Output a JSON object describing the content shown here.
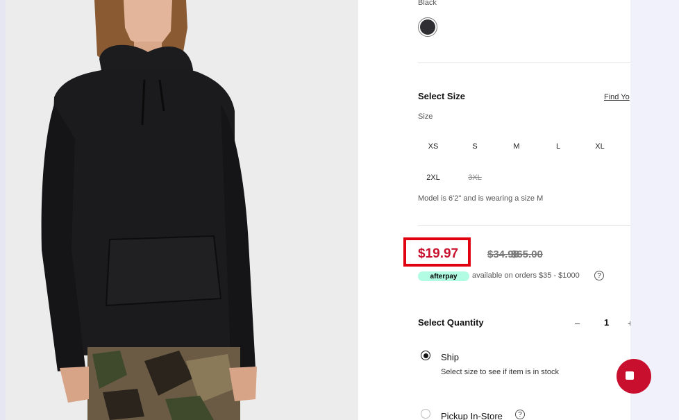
{
  "product": {
    "color_name": "Black",
    "swatch_color": "#2f2f33"
  },
  "size_section": {
    "title": "Select Size",
    "find_link": "Find Yo",
    "size_label": "Size",
    "sizes": [
      {
        "label": "XS",
        "available": true
      },
      {
        "label": "S",
        "available": true
      },
      {
        "label": "M",
        "available": true
      },
      {
        "label": "L",
        "available": true
      },
      {
        "label": "XL",
        "available": true
      },
      {
        "label": "2XL",
        "available": true
      },
      {
        "label": "3XL",
        "available": false
      }
    ],
    "model_note": "Model is 6'2\" and is wearing a size M"
  },
  "pricing": {
    "current_price": "$19.97",
    "old_price_1": "$34.98",
    "old_price_2": "$65.00",
    "afterpay_label": "afterpay",
    "afterpay_text": "available on orders $35 - $1000",
    "sale_color": "#c8102e",
    "highlight_color": "#e00010"
  },
  "quantity": {
    "label": "Select Quantity",
    "minus": "–",
    "value": "1",
    "plus": "+"
  },
  "fulfillment": {
    "ship_label": "Ship",
    "ship_sub": "Select size to see if item is in stock",
    "pickup_label": "Pickup In-Store"
  },
  "icons": {
    "help": "?",
    "chat": "chat-icon"
  }
}
